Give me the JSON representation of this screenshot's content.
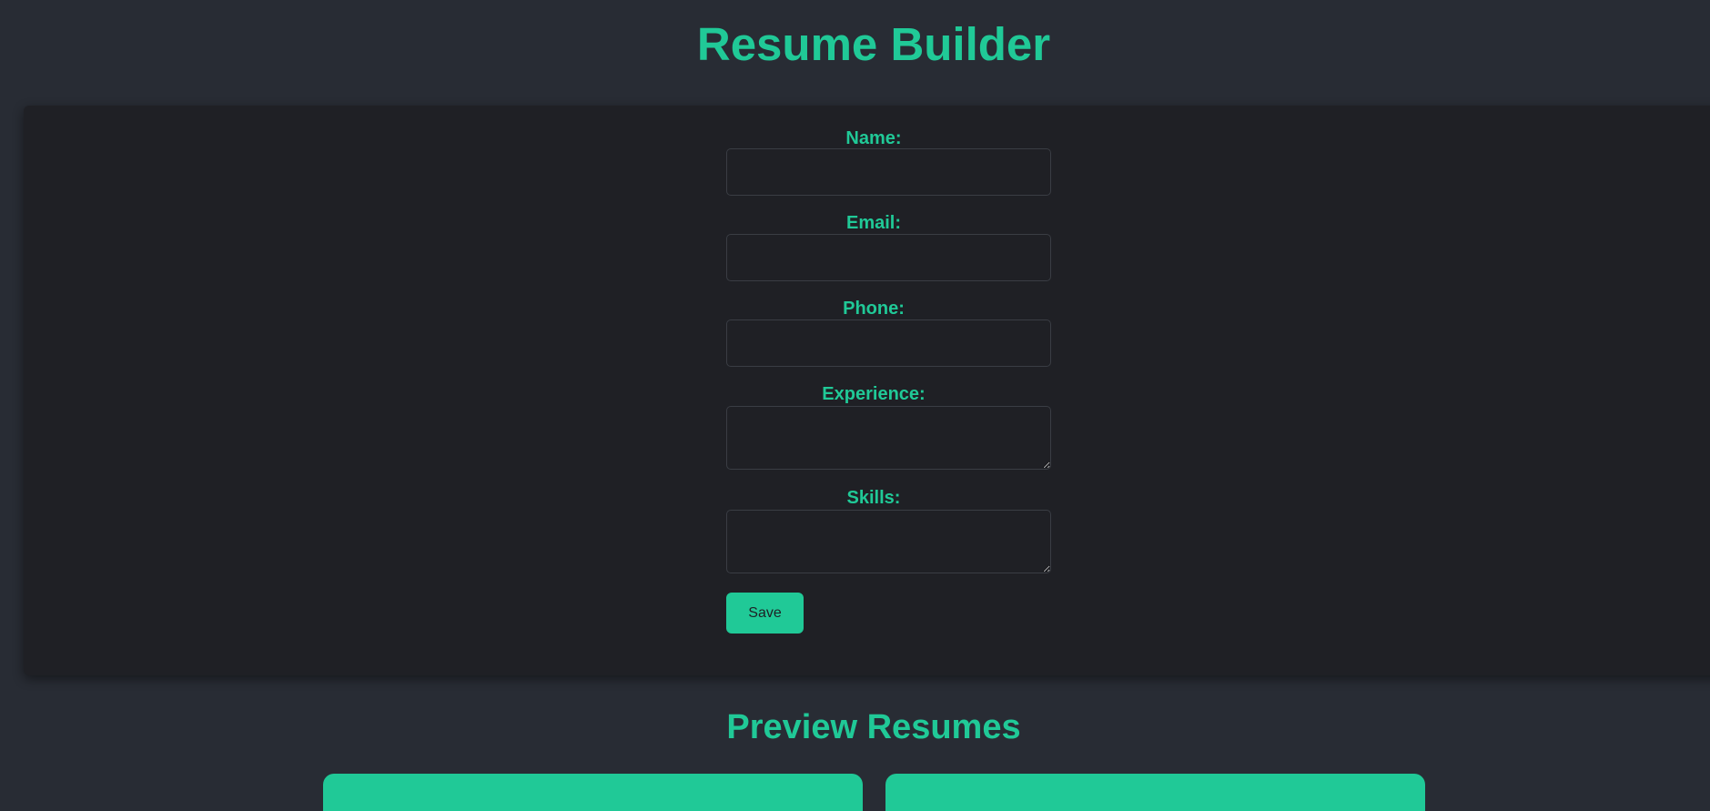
{
  "header": {
    "title": "Resume Builder"
  },
  "form": {
    "fields": [
      {
        "label": "Name:",
        "value": "",
        "placeholder": ""
      },
      {
        "label": "Email:",
        "value": "",
        "placeholder": ""
      },
      {
        "label": "Phone:",
        "value": "",
        "placeholder": ""
      },
      {
        "label": "Experience:",
        "value": "",
        "placeholder": ""
      },
      {
        "label": "Skills:",
        "value": "",
        "placeholder": ""
      }
    ],
    "save_label": "Save"
  },
  "preview": {
    "title": "Preview Resumes"
  },
  "colors": {
    "accent": "#20c997",
    "background": "#282c34",
    "panel": "#1f2025"
  }
}
